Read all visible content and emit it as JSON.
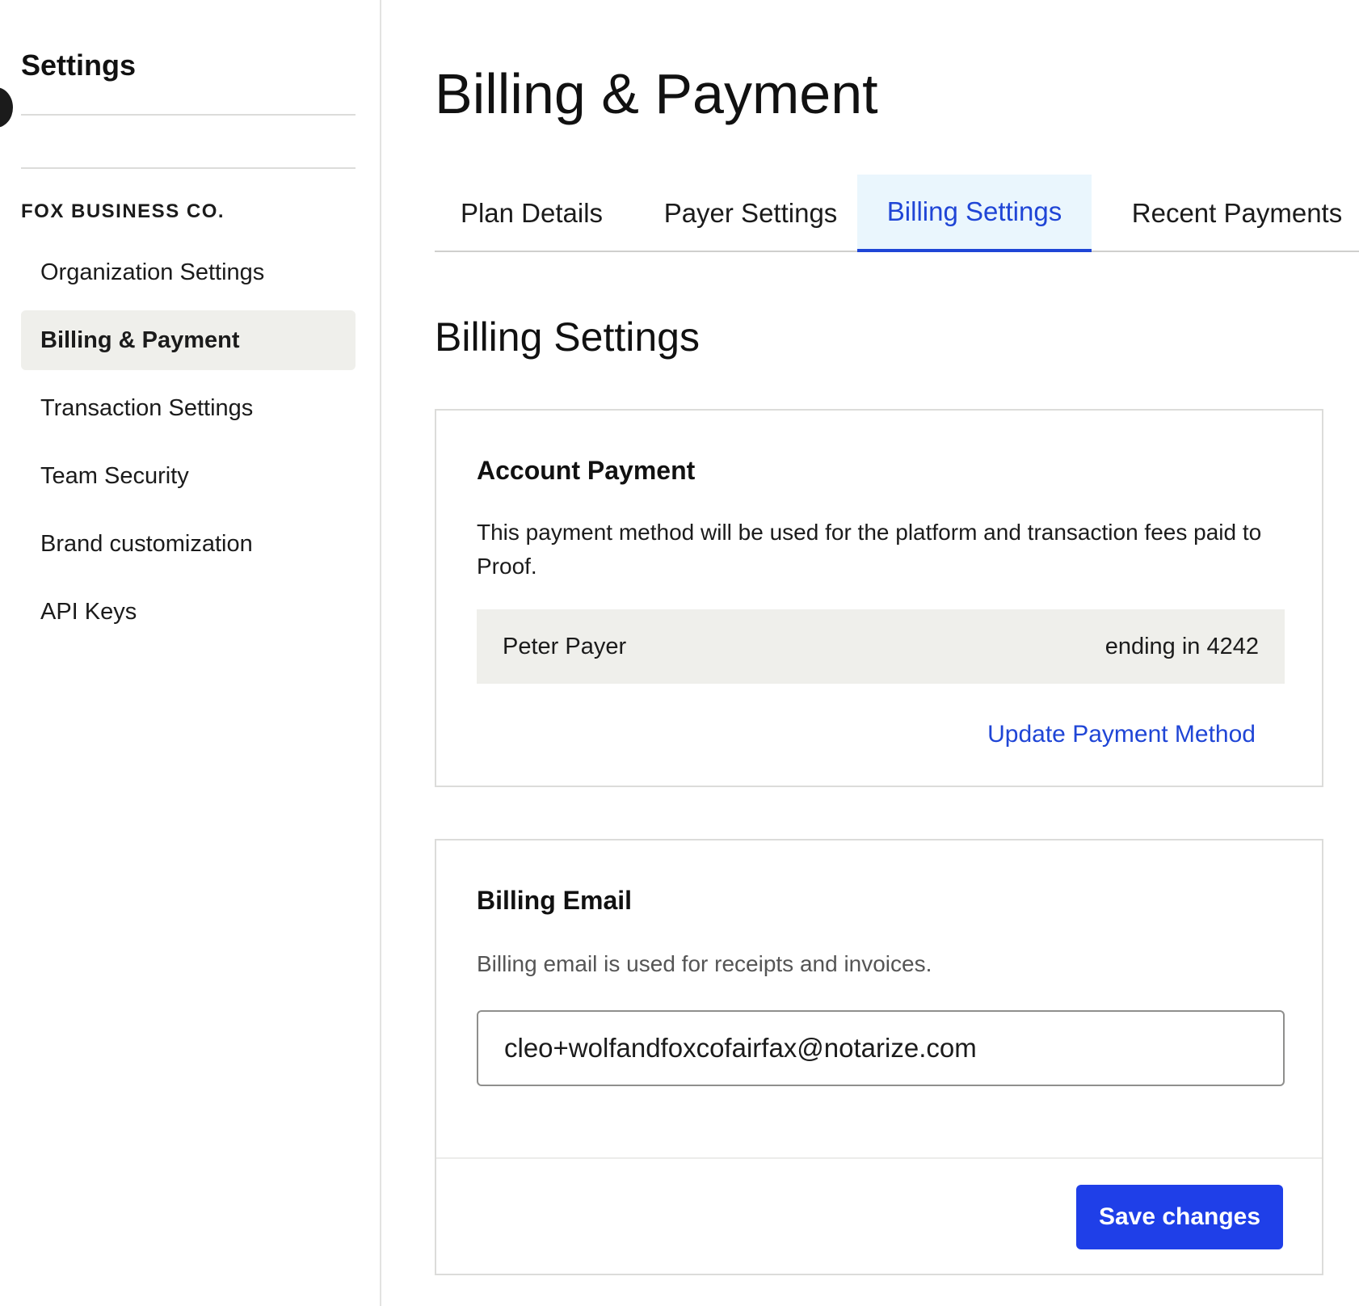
{
  "sidebar": {
    "title": "Settings",
    "org_label": "FOX BUSINESS CO.",
    "items": [
      {
        "label": "Organization Settings"
      },
      {
        "label": "Billing & Payment"
      },
      {
        "label": "Transaction Settings"
      },
      {
        "label": "Team Security"
      },
      {
        "label": "Brand customization"
      },
      {
        "label": "API Keys"
      }
    ],
    "active_item": "Billing & Payment"
  },
  "main": {
    "title": "Billing & Payment",
    "tabs": [
      {
        "label": "Plan Details"
      },
      {
        "label": "Payer Settings"
      },
      {
        "label": "Billing Settings"
      },
      {
        "label": "Recent Payments"
      }
    ],
    "active_tab": "Billing Settings",
    "section_title": "Billing Settings",
    "account_payment": {
      "heading": "Account Payment",
      "description": "This payment method will be used for the platform and transaction fees paid to Proof.",
      "payer_name": "Peter Payer",
      "card_ending": "ending in 4242",
      "update_link": "Update Payment Method"
    },
    "billing_email": {
      "heading": "Billing Email",
      "description": "Billing email is used for receipts and invoices.",
      "email_value": "cleo+wolfandfoxcofairfax@notarize.com",
      "save_label": "Save changes"
    }
  },
  "colors": {
    "accent": "#1f45d6",
    "button": "#1f3fe8",
    "active_tab_bg": "#eaf6fd",
    "active_nav_bg": "#efefeb"
  }
}
